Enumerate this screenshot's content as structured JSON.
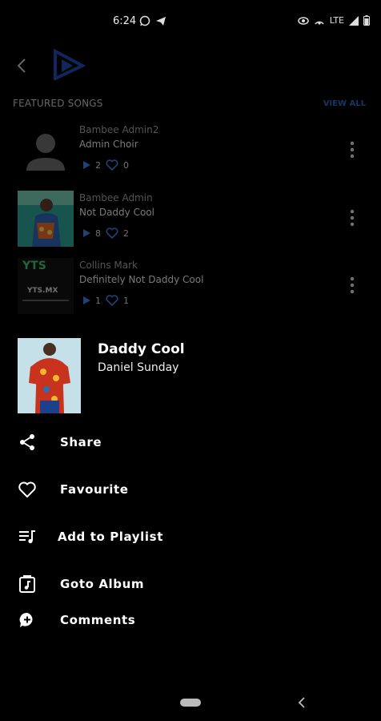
{
  "status_bar": {
    "time": "6:24",
    "network": "LTE"
  },
  "header": {
    "back_icon": "arrow-back-icon",
    "logo_icon": "play-logo-icon",
    "logo_color": "#1f47a8"
  },
  "featured": {
    "title": "FEATURED SONGS",
    "view_all": "VIEW ALL",
    "songs": [
      {
        "artist": "Bambee Admin2",
        "title": "Admin Choir",
        "plays": "2",
        "likes": "0"
      },
      {
        "artist": "Bambee Admin",
        "title": "Not Daddy Cool",
        "plays": "8",
        "likes": "2"
      },
      {
        "artist": "Collins Mark",
        "title": "Definitely Not Daddy Cool",
        "plays": "1",
        "likes": "1"
      }
    ],
    "thumb3_text": "YTS.MX",
    "thumb3_logo": "YTS"
  },
  "sheet": {
    "title": "Daddy Cool",
    "subtitle": "Daniel Sunday",
    "actions": [
      {
        "label": "Share",
        "icon": "share-icon"
      },
      {
        "label": "Favourite",
        "icon": "heart-icon"
      },
      {
        "label": "Add to Playlist",
        "icon": "playlist-add-icon"
      },
      {
        "label": "Goto Album",
        "icon": "album-icon"
      },
      {
        "label": "Comments",
        "icon": "comment-icon"
      }
    ]
  },
  "colors": {
    "accent": "#2b5fb5",
    "background": "#000000"
  }
}
